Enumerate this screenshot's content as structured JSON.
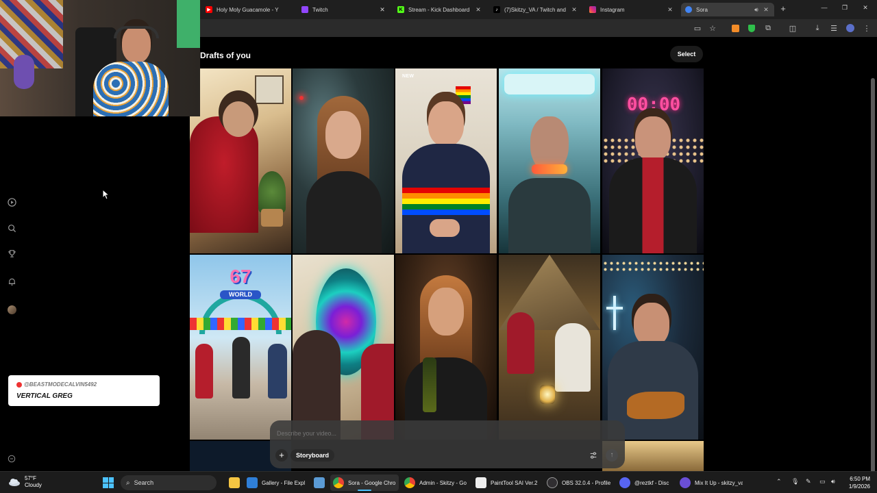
{
  "browser": {
    "tabs": [
      {
        "title": "Holy Moly Guacamole - Y",
        "favicon": "youtube-icon",
        "color": "#ff0000"
      },
      {
        "title": "Twitch",
        "favicon": "twitch-icon",
        "color": "#9146ff"
      },
      {
        "title": "Stream - Kick Dashboard",
        "favicon": "kick-icon",
        "color": "#53fc18"
      },
      {
        "title": "(7)Skitzy_VA / Twitch and",
        "favicon": "tiktok-icon",
        "color": "#000000"
      },
      {
        "title": "Instagram",
        "favicon": "instagram-icon",
        "color": "#e1306c"
      },
      {
        "title": "Sora",
        "favicon": "sora-icon",
        "color": "#4285f4",
        "active": true
      }
    ]
  },
  "sora": {
    "heading": "Drafts of you",
    "select_label": "Select",
    "nav": [
      "play-icon",
      "search-icon",
      "trophy-icon",
      "bell-icon",
      "avatar",
      "settings-icon"
    ],
    "tiles": [
      {
        "badge": ""
      },
      {
        "badge": ""
      },
      {
        "badge": "NEW"
      },
      {
        "badge": ""
      },
      {
        "badge": ""
      },
      {
        "badge": ""
      },
      {
        "badge": ""
      },
      {
        "badge": ""
      },
      {
        "badge": ""
      },
      {
        "badge": ""
      }
    ],
    "composer": {
      "placeholder": "Describe your video...",
      "storyboard_label": "Storyboard"
    }
  },
  "overlay": {
    "chat_user": "@BEASTMODECALVIN5492",
    "chat_message": "VERTICAL GREG",
    "neon_clock_text": "00:00",
    "sign_text": "67",
    "sign_subtext": "WORLD"
  },
  "taskbar": {
    "weather_temp": "57°F",
    "weather_desc": "Cloudy",
    "search_label": "Search",
    "apps": [
      {
        "label": "",
        "icon": "file-explorer-icon",
        "color": "#f5c542"
      },
      {
        "label": "Gallery - File Expl",
        "icon": "gallery-icon",
        "color": "#2f7fd8"
      },
      {
        "label": "",
        "icon": "photos-icon",
        "color": "#5b9bd5"
      },
      {
        "label": "Sora - Google Chro",
        "icon": "chrome-icon",
        "color": "#4285f4",
        "active": true
      },
      {
        "label": "Admin - Skitzy - Go",
        "icon": "chrome-icon",
        "color": "#4285f4"
      },
      {
        "label": "PaintTool SAI Ver.2",
        "icon": "painttool-icon",
        "color": "#eeeeee"
      },
      {
        "label": "OBS 32.0.4 - Profile",
        "icon": "obs-icon",
        "color": "#302e31"
      },
      {
        "label": "@reztkf - Disc",
        "icon": "discord-icon",
        "color": "#5865f2"
      },
      {
        "label": "Mix It Up - skitzy_va",
        "icon": "mixitup-icon",
        "color": "#6a4fd6"
      }
    ],
    "time": "6:50 PM",
    "date": "1/9/2026"
  }
}
